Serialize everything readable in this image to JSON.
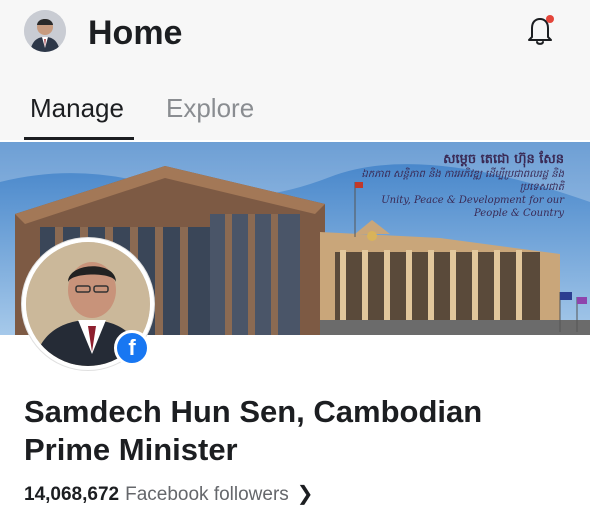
{
  "header": {
    "title": "Home",
    "avatar_icon": "profile-avatar",
    "notification_icon": "bell-icon",
    "notification_dot_color": "#e4453a"
  },
  "tabs": [
    {
      "label": "Manage",
      "active": true
    },
    {
      "label": "Explore",
      "active": false
    }
  ],
  "cover": {
    "line1": "សម្ដេច តេជោ ហ៊ុន សែន",
    "line2": "ឯកភាព សន្តិភាព និង ការអភិវឌ្ឍ ដើម្បីប្រជាពលរដ្ឋ និង ប្រទេសជាតិ",
    "line3": "Unity, Peace & Development for our People & Country"
  },
  "profile": {
    "name": "Samdech Hun Sen, Cambodian Prime Minister",
    "followers_count": "14,068,672",
    "followers_label": "Facebook followers",
    "badge_icon": "facebook-icon",
    "brand_color": "#1877f2"
  }
}
